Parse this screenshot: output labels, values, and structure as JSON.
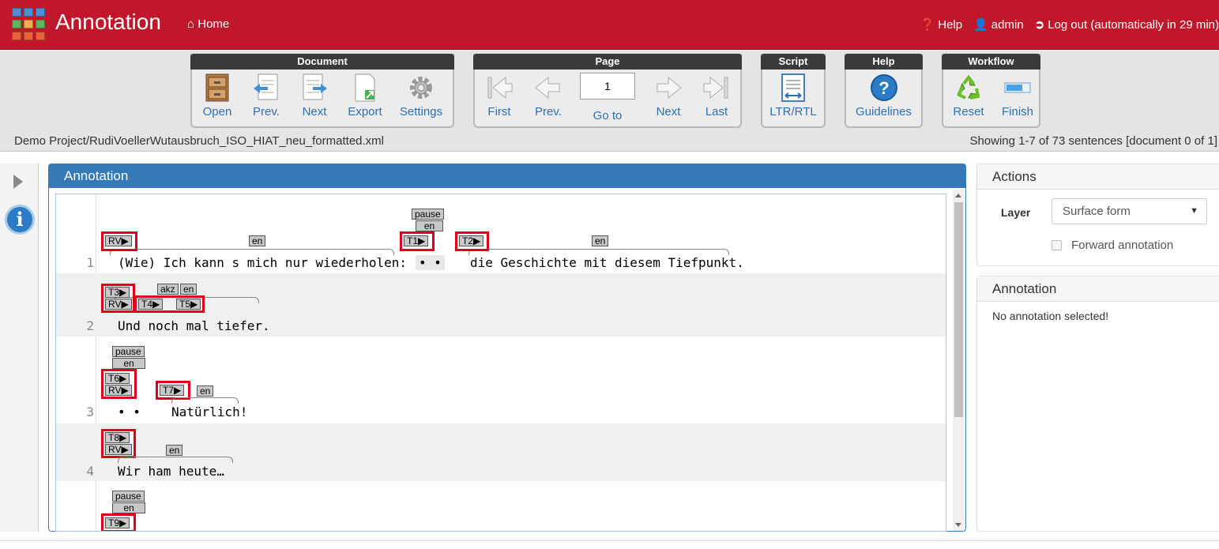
{
  "app": {
    "brand": "Annotation",
    "home": "Home"
  },
  "nav": {
    "help": "Help",
    "user": "admin",
    "logout": "Log out (automatically in 29 min)"
  },
  "toolbar": {
    "document": {
      "title": "Document",
      "open": "Open",
      "prev": "Prev.",
      "next": "Next",
      "export": "Export",
      "settings": "Settings"
    },
    "page": {
      "title": "Page",
      "first": "First",
      "prev": "Prev.",
      "goto": "Go to",
      "next": "Next",
      "last": "Last",
      "value": "1"
    },
    "script": {
      "title": "Script",
      "ltr": "LTR/RTL"
    },
    "help": {
      "title": "Help",
      "guidelines": "Guidelines"
    },
    "workflow": {
      "title": "Workflow",
      "reset": "Reset",
      "finish": "Finish"
    }
  },
  "status": {
    "doc_path": "Demo Project/RudiVoellerWutausbruch_ISO_HIAT_neu_formatted.xml",
    "showing": "Showing 1-7 of 73 sentences [document 0 of 1]"
  },
  "annotation_panel": {
    "title": "Annotation",
    "sentences": [
      {
        "num": "1",
        "text_a": "(Wie) Ich kann s mich nur wiederholen:",
        "text_b": "• •",
        "text_c": "die Geschichte mit diesem Tiefpunkt."
      },
      {
        "num": "2",
        "text_a": "Und noch mal tiefer."
      },
      {
        "num": "3",
        "text_a": "• •",
        "text_b": "Natürlich!"
      },
      {
        "num": "4",
        "text_a": "Wir ham heute…"
      }
    ],
    "tags": {
      "rv": "RV▶",
      "t1": "T1▶",
      "t2": "T2▶",
      "t3": "T3▶",
      "t4": "T4▶",
      "t5": "T5▶",
      "t6": "T6▶",
      "t7": "T7▶",
      "t8": "T8▶",
      "t9": "T9▶",
      "en": "en",
      "pause": "pause",
      "akz": "akz"
    }
  },
  "actions_panel": {
    "title": "Actions",
    "layer_label": "Layer",
    "layer_value": "Surface form",
    "forward": "Forward annotation"
  },
  "detail_panel": {
    "title": "Annotation",
    "empty": "No annotation selected!"
  },
  "colors": {
    "brand_red": "#c0172b",
    "primary_blue": "#337ab7",
    "highlight_red": "#e0001b"
  }
}
